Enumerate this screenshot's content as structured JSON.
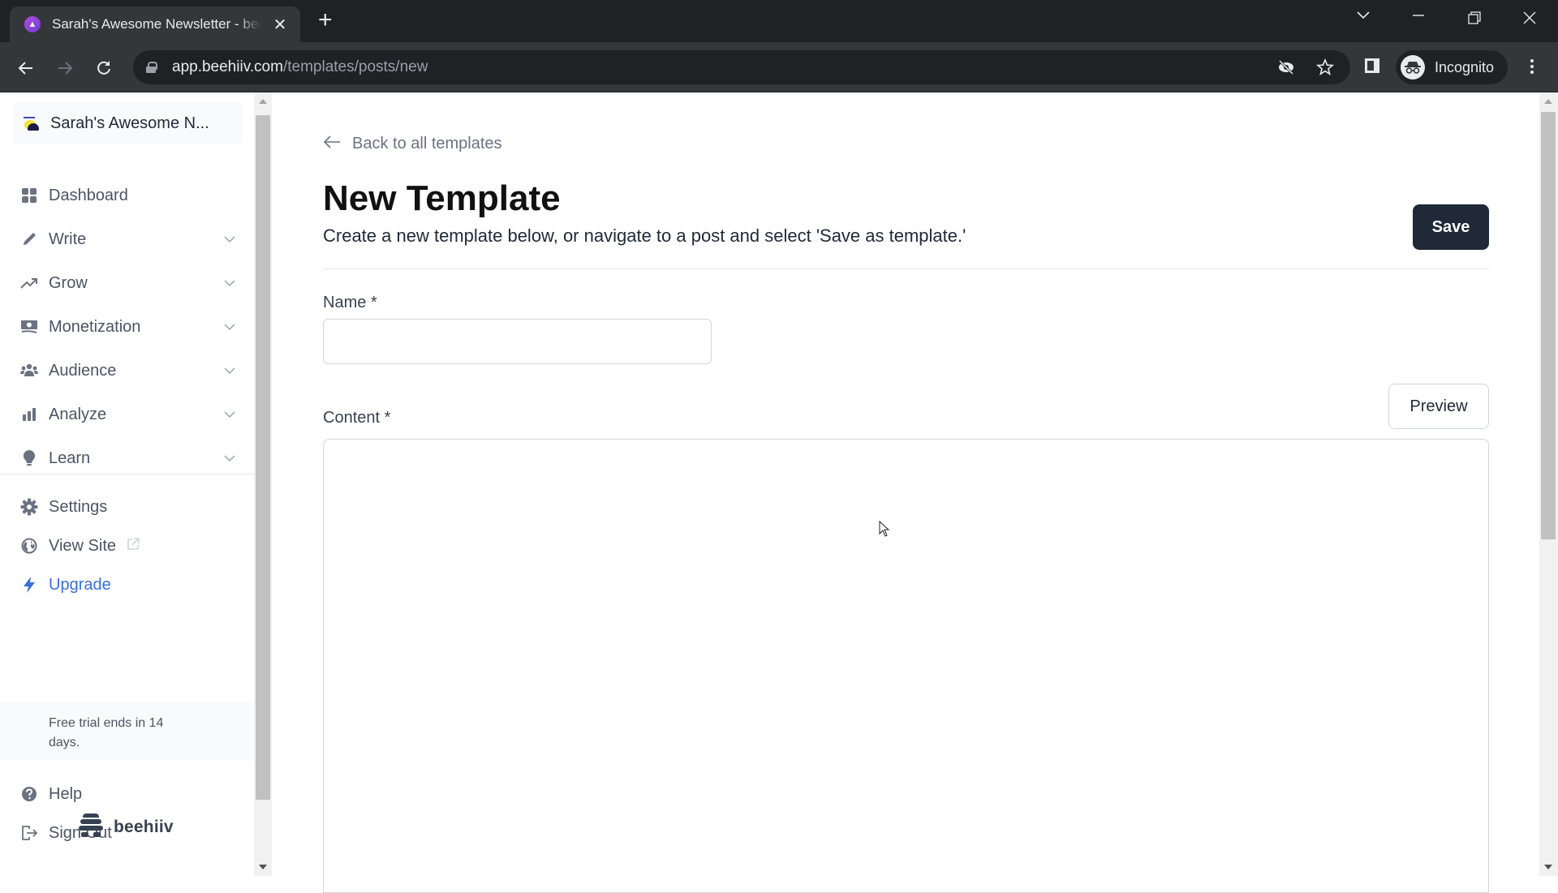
{
  "browser": {
    "tab": {
      "title": "Sarah's Awesome Newsletter - beehiiv",
      "favicon": "beehiiv-favicon-icon"
    },
    "url": {
      "host": "app.beehiiv.com",
      "path": "/templates/posts/new"
    },
    "profile_label": "Incognito",
    "icons": [
      "back-icon",
      "forward-icon",
      "reload-icon",
      "lock-icon",
      "eye-off-icon",
      "star-icon",
      "side-panel-icon",
      "incognito-icon",
      "kebab-menu-icon",
      "tab-search-icon",
      "minimize-icon",
      "restore-icon",
      "close-icon"
    ]
  },
  "sidebar": {
    "publication": "Sarah's Awesome N...",
    "items": [
      {
        "label": "Dashboard",
        "icon": "grid-icon",
        "expandable": false
      },
      {
        "label": "Write",
        "icon": "pencil-icon",
        "expandable": true
      },
      {
        "label": "Grow",
        "icon": "trend-up-icon",
        "expandable": true
      },
      {
        "label": "Monetization",
        "icon": "cash-icon",
        "expandable": true
      },
      {
        "label": "Audience",
        "icon": "users-icon",
        "expandable": true
      },
      {
        "label": "Analyze",
        "icon": "bar-chart-icon",
        "expandable": true
      },
      {
        "label": "Learn",
        "icon": "lightbulb-icon",
        "expandable": true
      }
    ],
    "secondary": [
      {
        "label": "Settings",
        "icon": "gear-icon"
      },
      {
        "label": "View Site",
        "icon": "globe-icon",
        "trailing_icon": "external-link-icon"
      },
      {
        "label": "Upgrade",
        "icon": "lightning-icon"
      }
    ],
    "trial_notice": "Free trial ends in 14 days.",
    "footer": [
      {
        "label": "Help",
        "icon": "help-circle-icon"
      },
      {
        "label": "Sign Out",
        "icon": "sign-out-icon"
      }
    ],
    "brand": "beehiiv"
  },
  "main": {
    "back_link": "Back to all templates",
    "title": "New Template",
    "subtitle": "Create a new template below, or navigate to a post and select 'Save as template.'",
    "save_label": "Save",
    "name_label": "Name *",
    "name_value": "",
    "content_label": "Content *",
    "preview_label": "Preview"
  },
  "colors": {
    "chrome_dark": "#202124",
    "chrome_tab": "#35363a",
    "primary_button": "#1f2937",
    "upgrade_accent": "#3b6fd8",
    "text_muted": "#6b7280"
  }
}
